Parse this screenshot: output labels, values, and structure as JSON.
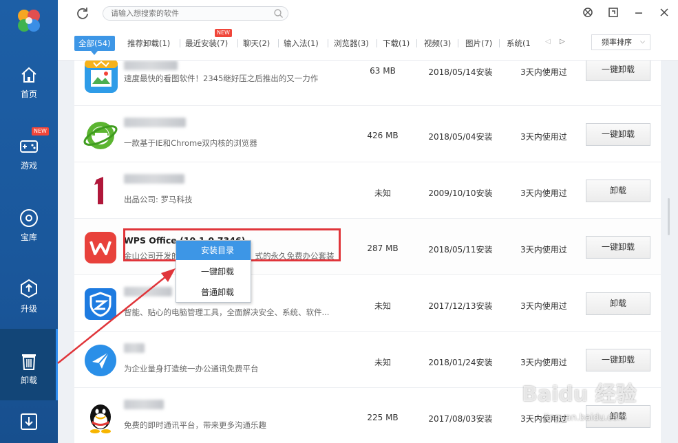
{
  "sidebar": {
    "items": [
      {
        "label": "首页"
      },
      {
        "label": "游戏",
        "badge": "NEW"
      },
      {
        "label": "宝库"
      },
      {
        "label": "升级"
      },
      {
        "label": "卸载"
      },
      {
        "label": ""
      }
    ]
  },
  "topbar": {
    "search_placeholder": "请输入想搜索的软件"
  },
  "tabs": [
    {
      "label": "全部(54)"
    },
    {
      "label": "推荐卸载(1)"
    },
    {
      "label": "最近安装(7)",
      "badge": "NEW"
    },
    {
      "label": "聊天(2)"
    },
    {
      "label": "输入法(1)"
    },
    {
      "label": "浏览器(3)"
    },
    {
      "label": "下载(1)"
    },
    {
      "label": "视频(3)"
    },
    {
      "label": "图片(7)"
    },
    {
      "label": "系统(1"
    }
  ],
  "sort": {
    "label": "频率排序"
  },
  "rows": [
    {
      "name": "",
      "desc": "速度最快的看图软件！2345继好压之后推出的又一力作",
      "size": "63 MB",
      "date": "2018/05/14安装",
      "used": "3天内使用过",
      "button": "一键卸载"
    },
    {
      "name": "",
      "desc": "一款基于IE和Chrome双内核的浏览器",
      "size": "426 MB",
      "date": "2018/05/04安装",
      "used": "3天内使用过",
      "button": "一键卸载"
    },
    {
      "name": "",
      "desc": "出品公司: 罗马科技",
      "size": "未知",
      "date": "2009/10/10安装",
      "used": "3天内使用过",
      "button": "卸载"
    },
    {
      "name": "WPS Office (10.1.0.7346)",
      "desc": "金山公司开发的",
      "desc2": "式的永久免费办公套装",
      "size": "287 MB",
      "date": "2018/05/11安装",
      "used": "3天内使用过",
      "button": "一键卸载"
    },
    {
      "name": "",
      "desc": "智能、贴心的电脑管理工具，全面解决安全、系统、软件...",
      "size": "未知",
      "date": "2017/12/13安装",
      "used": "3天内使用过",
      "button": "卸载"
    },
    {
      "name": "",
      "desc": "为企业量身打造统一办公通讯免费平台",
      "size": "未知",
      "date": "2018/01/24安装",
      "used": "3天内使用过",
      "button": "一键卸载"
    },
    {
      "name": "",
      "desc": "免费的即时通讯平台，带来更多沟通乐趣",
      "size": "225 MB",
      "date": "2017/08/03安装",
      "used": "3天内使用过",
      "button": "卸载"
    }
  ],
  "context_menu": {
    "items": [
      {
        "label": "安装目录"
      },
      {
        "label": "一键卸载"
      },
      {
        "label": "普通卸载"
      }
    ]
  },
  "watermark": {
    "line1": "Baidu 经验",
    "line2": "jingyan.baidu.com"
  },
  "colors": {
    "accent": "#3d96e6",
    "sidebar": "#1d5fa6",
    "highlight": "#e0353a"
  }
}
